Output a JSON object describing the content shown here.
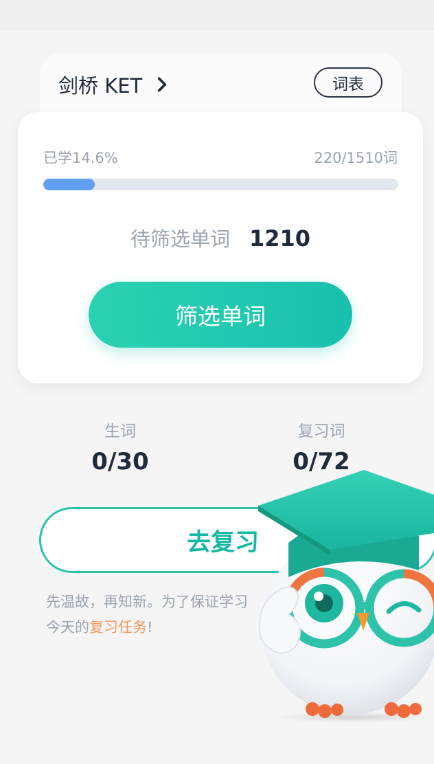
{
  "book": {
    "title": "剑桥 KET",
    "wordlist_button": "词表"
  },
  "progress": {
    "learned_label": "已学14.6%",
    "count_label": "220/1510词",
    "learned_fraction": 0.146
  },
  "pending": {
    "label": "待筛选单词",
    "value": "1210"
  },
  "filter_button": "筛选单词",
  "stats": {
    "new_words": {
      "label": "生词",
      "value": "0/30"
    },
    "review_words": {
      "label": "复习词",
      "value": "0/72"
    }
  },
  "review_button": "去复习",
  "tip": {
    "line1": "先温故，再知新。为了保证学习",
    "line2_prefix": "今天的",
    "line2_highlight": "复习任务",
    "line2_suffix": "!"
  },
  "colors": {
    "accent": "#19c0ae",
    "progress": "#619ff2",
    "highlight": "#f09a5e"
  },
  "icons": {
    "book_chevron": "chevron-right-icon",
    "mascot": "owl-mascot"
  }
}
